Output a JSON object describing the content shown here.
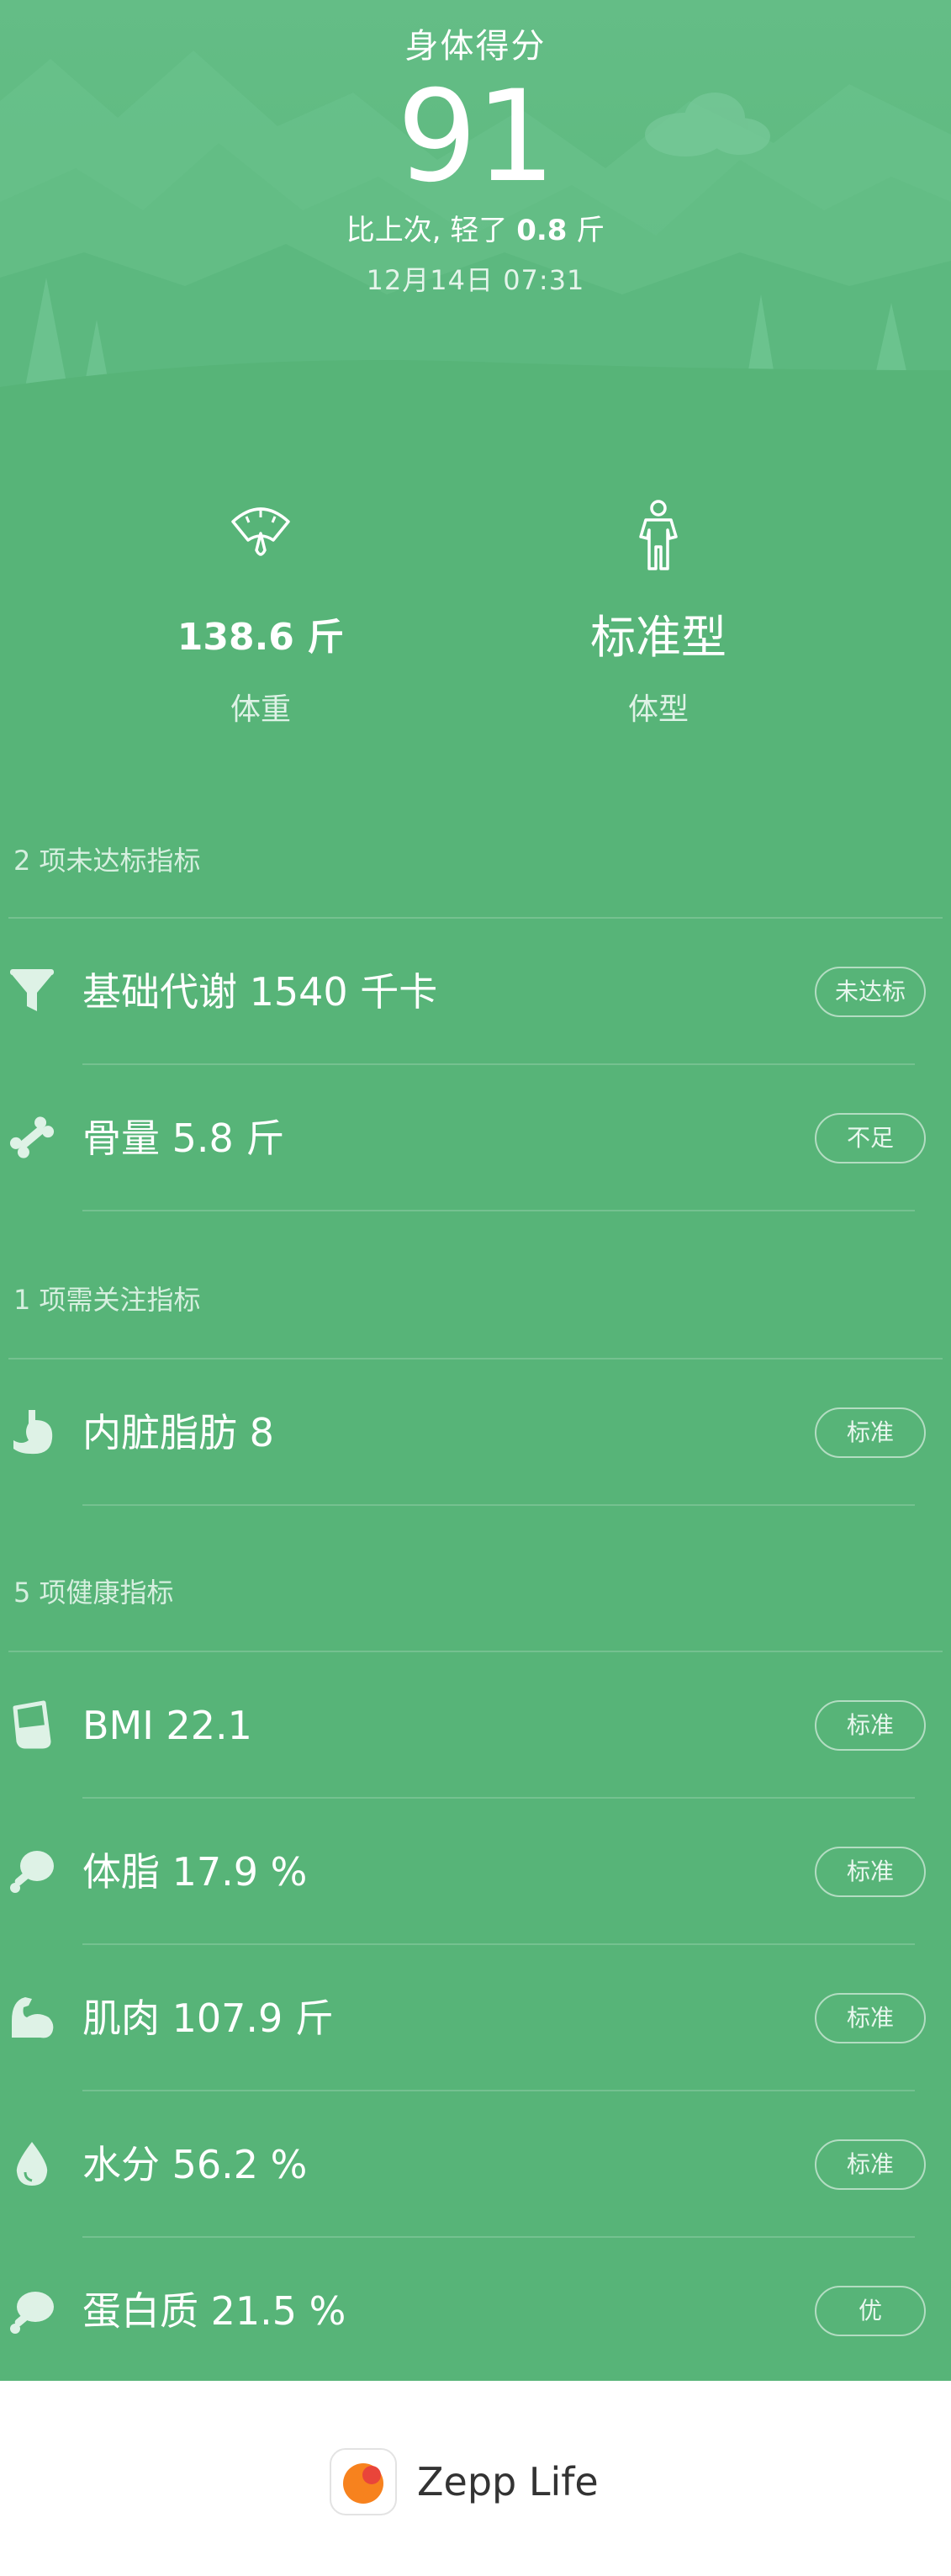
{
  "header": {
    "title": "身体得分",
    "score": "91",
    "change_prefix": "比上次, 轻了",
    "change_value": "0.8",
    "change_unit": "斤",
    "datetime": "12月14日 07:31"
  },
  "stats": {
    "weight": {
      "value": "138.6 斤",
      "label": "体重",
      "icon": "scale-icon"
    },
    "body_type": {
      "value": "标准型",
      "label": "体型",
      "icon": "body-figure-icon"
    }
  },
  "sections": [
    {
      "title": "2 项未达标指标",
      "items": [
        {
          "label": "基础代谢 1540 千卡",
          "badge": "未达标",
          "icon": "funnel-icon"
        },
        {
          "label": "骨量 5.8 斤",
          "badge": "不足",
          "icon": "bone-icon"
        }
      ]
    },
    {
      "title": "1 项需关注指标",
      "items": [
        {
          "label": "内脏脂肪 8",
          "badge": "标准",
          "icon": "stomach-icon"
        }
      ]
    },
    {
      "title": "5 项健康指标",
      "items": [
        {
          "label": "BMI 22.1",
          "badge": "标准",
          "icon": "cup-icon"
        },
        {
          "label": "体脂 17.9 %",
          "badge": "标准",
          "icon": "drumstick-icon"
        },
        {
          "label": "肌肉 107.9 斤",
          "badge": "标准",
          "icon": "muscle-icon"
        },
        {
          "label": "水分 56.2 %",
          "badge": "标准",
          "icon": "water-drop-icon"
        },
        {
          "label": "蛋白质 21.5 %",
          "badge": "优",
          "icon": "protein-icon"
        }
      ]
    }
  ],
  "footer": {
    "brand": "Zepp Life"
  },
  "colors": {
    "background": "#57b478",
    "hero_top": "#6ac28c",
    "text": "#ffffff",
    "logo_orange": "#f7821e"
  }
}
